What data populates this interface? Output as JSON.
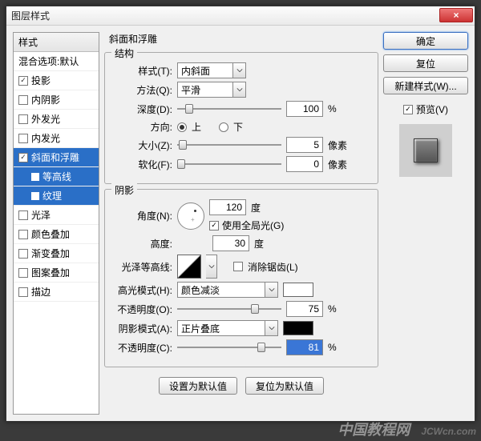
{
  "title": "图层样式",
  "close": "×",
  "left": {
    "header": "样式",
    "blend": "混合选项:默认",
    "items": [
      {
        "label": "投影",
        "checked": true,
        "sel": false
      },
      {
        "label": "内阴影",
        "checked": false,
        "sel": false
      },
      {
        "label": "外发光",
        "checked": false,
        "sel": false
      },
      {
        "label": "内发光",
        "checked": false,
        "sel": false
      },
      {
        "label": "斜面和浮雕",
        "checked": true,
        "sel": true
      },
      {
        "label": "等高线",
        "indent": true,
        "sel": true
      },
      {
        "label": "纹理",
        "indent": true,
        "sel": true
      },
      {
        "label": "光泽",
        "checked": false,
        "sel": false
      },
      {
        "label": "颜色叠加",
        "checked": false,
        "sel": false
      },
      {
        "label": "渐变叠加",
        "checked": false,
        "sel": false
      },
      {
        "label": "图案叠加",
        "checked": false,
        "sel": false
      },
      {
        "label": "描边",
        "checked": false,
        "sel": false
      }
    ]
  },
  "center": {
    "title": "斜面和浮雕",
    "g1": {
      "legend": "结构",
      "style_label": "样式(T):",
      "style_value": "内斜面",
      "tech_label": "方法(Q):",
      "tech_value": "平滑",
      "depth_label": "深度(D):",
      "depth_value": "100",
      "percent": "%",
      "dir_label": "方向:",
      "up": "上",
      "down": "下",
      "size_label": "大小(Z):",
      "size_value": "5",
      "px": "像素",
      "soften_label": "软化(F):",
      "soften_value": "0"
    },
    "g2": {
      "legend": "阴影",
      "angle_label": "角度(N):",
      "angle_value": "120",
      "deg": "度",
      "global": "使用全局光(G)",
      "alt_label": "高度:",
      "alt_value": "30",
      "gloss_label": "光泽等高线:",
      "aa": "消除锯齿(L)",
      "hmode_label": "高光模式(H):",
      "hmode_value": "颜色减淡",
      "hcolor": "#ffffff",
      "hopacity_label": "不透明度(O):",
      "hopacity_value": "75",
      "smode_label": "阴影模式(A):",
      "smode_value": "正片叠底",
      "scolor": "#000000",
      "sopacity_label": "不透明度(C):",
      "sopacity_value": "81"
    },
    "btn_default": "设置为默认值",
    "btn_reset": "复位为默认值"
  },
  "right": {
    "ok": "确定",
    "cancel": "复位",
    "newstyle": "新建样式(W)...",
    "preview": "预览(V)"
  },
  "watermark": {
    "a": "中国教程网",
    "b": "JCWcn.com"
  },
  "chart_data": null
}
